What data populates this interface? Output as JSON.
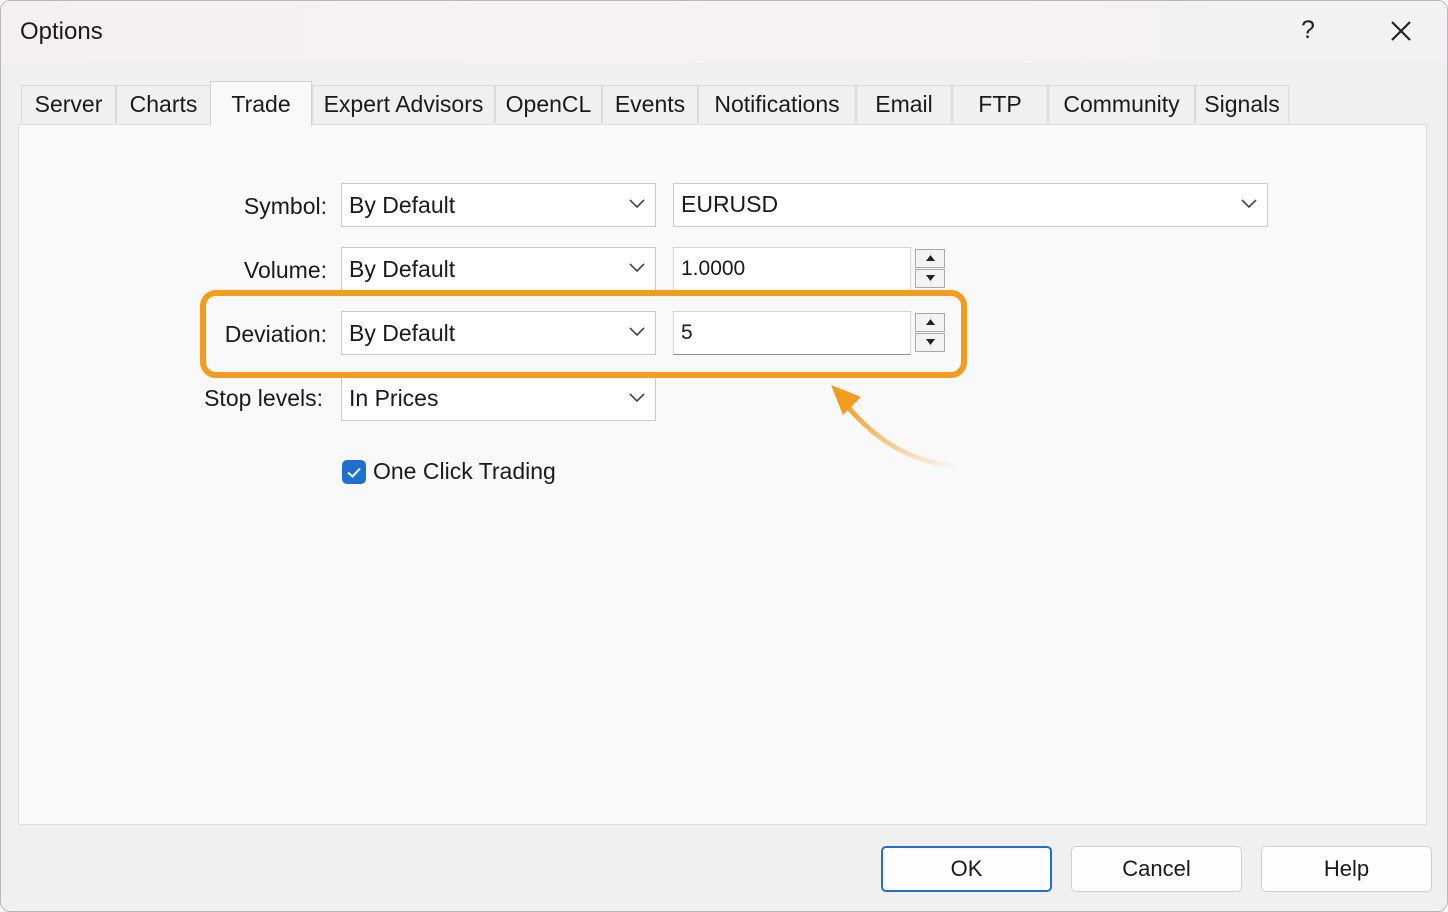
{
  "window": {
    "title": "Options",
    "help_label": "?"
  },
  "tabs": [
    {
      "label": "Server"
    },
    {
      "label": "Charts"
    },
    {
      "label": "Trade"
    },
    {
      "label": "Expert Advisors"
    },
    {
      "label": "OpenCL"
    },
    {
      "label": "Events"
    },
    {
      "label": "Notifications"
    },
    {
      "label": "Email"
    },
    {
      "label": "FTP"
    },
    {
      "label": "Community"
    },
    {
      "label": "Signals"
    }
  ],
  "active_tab": "Trade",
  "trade": {
    "symbol": {
      "label": "Symbol:",
      "mode": "By Default",
      "value": "EURUSD"
    },
    "volume": {
      "label": "Volume:",
      "mode": "By Default",
      "value": "1.0000"
    },
    "deviation": {
      "label": "Deviation:",
      "mode": "By Default",
      "value": "5"
    },
    "stop_levels": {
      "label": "Stop levels:",
      "mode": "In Prices"
    },
    "one_click": {
      "label": "One Click Trading",
      "checked": true
    }
  },
  "buttons": {
    "ok": "OK",
    "cancel": "Cancel",
    "help": "Help"
  },
  "colors": {
    "highlight": "#f39c1e",
    "accent": "#1f6fcf"
  }
}
